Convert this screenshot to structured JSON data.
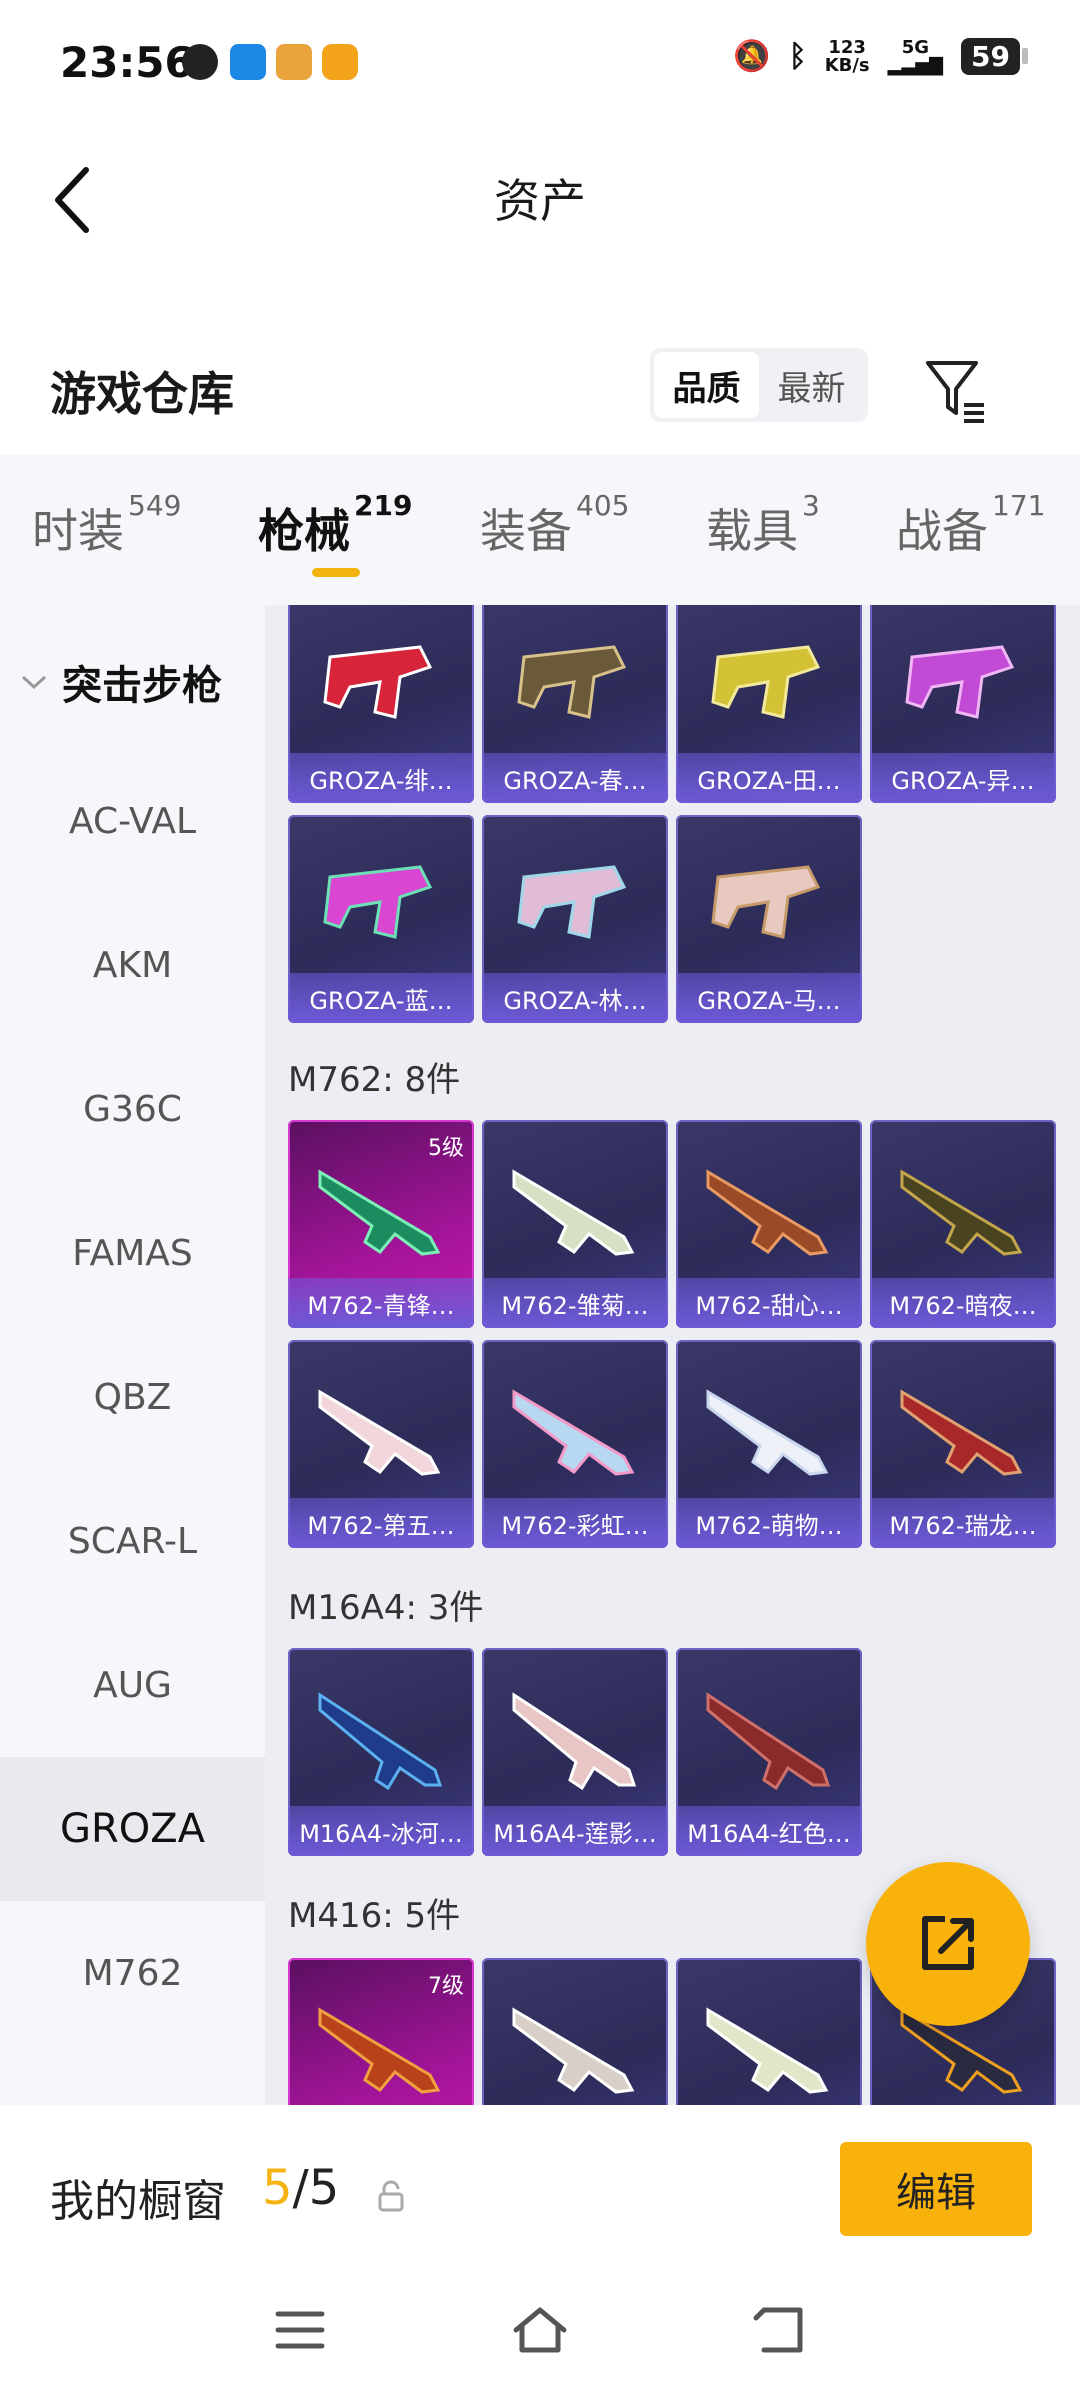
{
  "status_bar": {
    "time": "23:56",
    "net_speed": "123\nKB/s",
    "net_speed_top": "123",
    "net_speed_bottom": "KB/s",
    "network": "5G",
    "battery": "59"
  },
  "header": {
    "title": "资产"
  },
  "section": {
    "title": "游戏仓库",
    "sort_options": [
      "品质",
      "最新"
    ],
    "sort_selected": "品质"
  },
  "tabs": [
    {
      "label": "时装",
      "count": "549"
    },
    {
      "label": "枪械",
      "count": "219"
    },
    {
      "label": "装备",
      "count": "405"
    },
    {
      "label": "载具",
      "count": "3"
    },
    {
      "label": "战备",
      "count": "171"
    }
  ],
  "sidebar": {
    "group": "突击步枪",
    "items": [
      "AC-VAL",
      "AKM",
      "G36C",
      "FAMAS",
      "QBZ",
      "SCAR-L",
      "AUG",
      "GROZA",
      "M762"
    ],
    "active": "GROZA"
  },
  "groups": {
    "groza": {
      "items": [
        "GROZA-绯…",
        "GROZA-春…",
        "GROZA-田…",
        "GROZA-异…",
        "GROZA-蓝…",
        "GROZA-林…",
        "GROZA-马…"
      ]
    },
    "m762": {
      "header": "M762: 8件",
      "items": [
        "M762-青锋…",
        "M762-雏菊…",
        "M762-甜心…",
        "M762-暗夜…",
        "M762-第五…",
        "M762-彩虹…",
        "M762-萌物…",
        "M762-瑞龙…"
      ],
      "first_level": "5级"
    },
    "m16a4": {
      "header": "M16A4: 3件",
      "items": [
        "M16A4-冰河…",
        "M16A4-莲影…",
        "M16A4-红色…"
      ]
    },
    "m416": {
      "header": "M416: 5件",
      "first_level": "7级"
    }
  },
  "bottom": {
    "label": "我的橱窗",
    "count_current": "5",
    "count_total": "/5",
    "edit_label": "编辑"
  },
  "colors": {
    "accent": "#f9b20c",
    "card_bg": "#2d2b58",
    "card_label": "#6c5ad6",
    "gold_card": "#a21498"
  }
}
